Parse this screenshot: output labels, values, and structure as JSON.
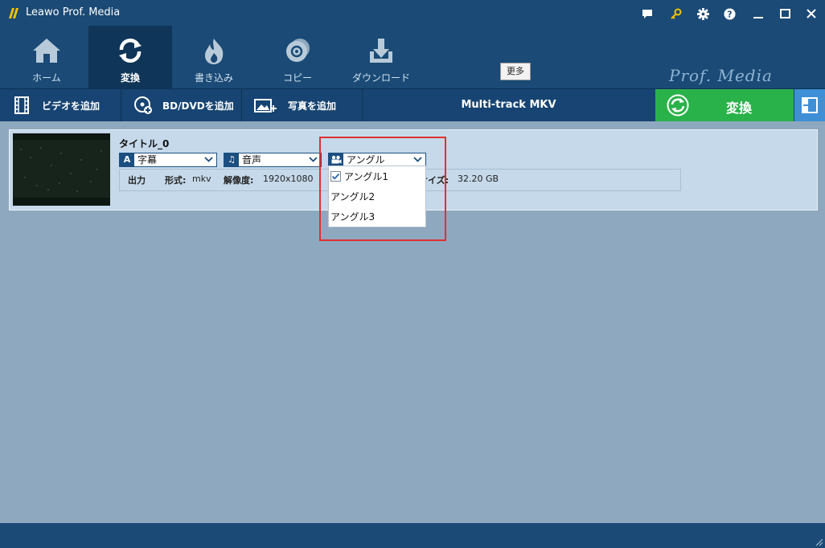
{
  "window": {
    "title": "Leawo Prof. Media",
    "buttons": [
      "chat-icon",
      "key-icon",
      "gear-icon",
      "help-icon",
      "minimize-icon",
      "maximize-icon",
      "close-icon"
    ]
  },
  "nav": {
    "items": [
      {
        "label": "ホーム",
        "icon": "home-icon"
      },
      {
        "label": "変換",
        "icon": "convert-icon",
        "active": true
      },
      {
        "label": "書き込み",
        "icon": "burn-icon"
      },
      {
        "label": "コピー",
        "icon": "copy-icon"
      },
      {
        "label": "ダウンロード",
        "icon": "download-icon"
      }
    ],
    "more_label": "更多",
    "brand": "Prof. Media"
  },
  "toolbar": {
    "add_video": "ビデオを追加",
    "add_bd_dvd": "BD/DVDを追加",
    "add_photo": "写真を追加",
    "format": "Multi-track MKV",
    "convert": "変換"
  },
  "item": {
    "title": "タイトル_0",
    "subtitle_select": "字幕",
    "audio_select": "音声",
    "angle_select": "アングル",
    "info": {
      "output_label": "出力",
      "format_label": "形式:",
      "format_value": "mkv",
      "resolution_label": "解像度:",
      "resolution_value": "1920x1080",
      "size_label": "サイズ:",
      "size_value": "32.20 GB"
    }
  },
  "angle_menu": {
    "options": [
      {
        "label": "アングル1",
        "checked": true
      },
      {
        "label": "アングル2",
        "checked": false
      },
      {
        "label": "アングル3",
        "checked": false
      }
    ]
  },
  "colors": {
    "header": "#1a4a75",
    "active_nav": "#0f3558",
    "convert_button": "#2ab24a",
    "highlight_box": "#e03030"
  }
}
